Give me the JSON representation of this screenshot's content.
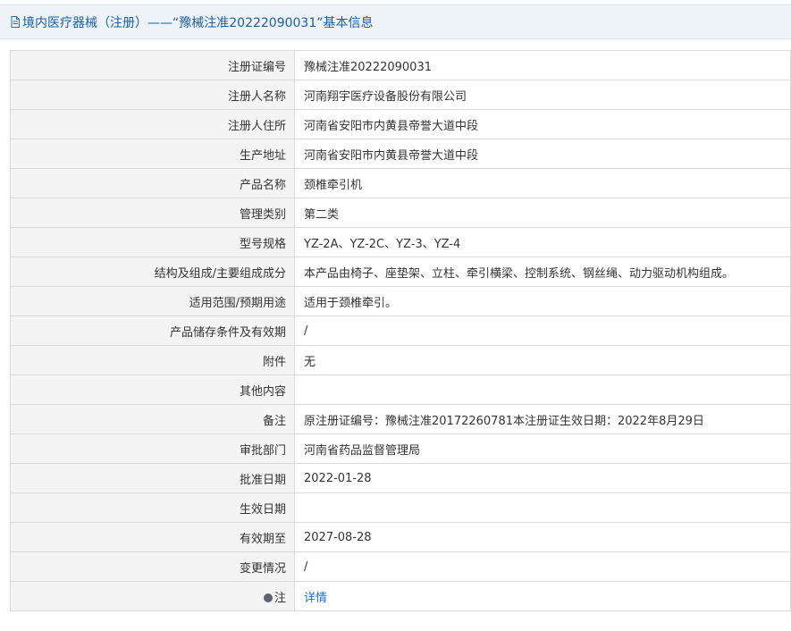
{
  "header": {
    "icon": "document-icon",
    "title": "境内医疗器械（注册）——“豫械注准20222090031”基本信息"
  },
  "rows": [
    {
      "label": "注册证编号",
      "value": "豫械注准20222090031"
    },
    {
      "label": "注册人名称",
      "value": "河南翔宇医疗设备股份有限公司"
    },
    {
      "label": "注册人住所",
      "value": "河南省安阳市内黄县帝誉大道中段"
    },
    {
      "label": "生产地址",
      "value": "河南省安阳市内黄县帝誉大道中段"
    },
    {
      "label": "产品名称",
      "value": "颈椎牵引机"
    },
    {
      "label": "管理类别",
      "value": "第二类"
    },
    {
      "label": "型号规格",
      "value": "YZ-2A、YZ-2C、YZ-3、YZ-4"
    },
    {
      "label": "结构及组成/主要组成成分",
      "value": "本产品由椅子、座垫架、立柱、牵引横梁、控制系统、钢丝绳、动力驱动机构组成。"
    },
    {
      "label": "适用范围/预期用途",
      "value": "适用于颈椎牵引。"
    },
    {
      "label": "产品储存条件及有效期",
      "value": "/"
    },
    {
      "label": "附件",
      "value": "无"
    },
    {
      "label": "其他内容",
      "value": ""
    },
    {
      "label": "备注",
      "value": "原注册证编号：豫械注准20172260781本注册证生效日期：2022年8月29日"
    },
    {
      "label": "审批部门",
      "value": "河南省药品监督管理局"
    },
    {
      "label": "批准日期",
      "value": "2022-01-28"
    },
    {
      "label": "生效日期",
      "value": ""
    },
    {
      "label": "有效期至",
      "value": "2027-08-28"
    },
    {
      "label": "变更情况",
      "value": "/"
    }
  ],
  "note_row": {
    "icon": "note-dot-icon",
    "label": "注",
    "link_text": "详情"
  },
  "colors": {
    "title": "#1a5fa6",
    "link": "#1a6fd0",
    "label_bg": "#f4f4f4",
    "border": "#d9d9d9",
    "header_bg": "#eef3f8"
  }
}
